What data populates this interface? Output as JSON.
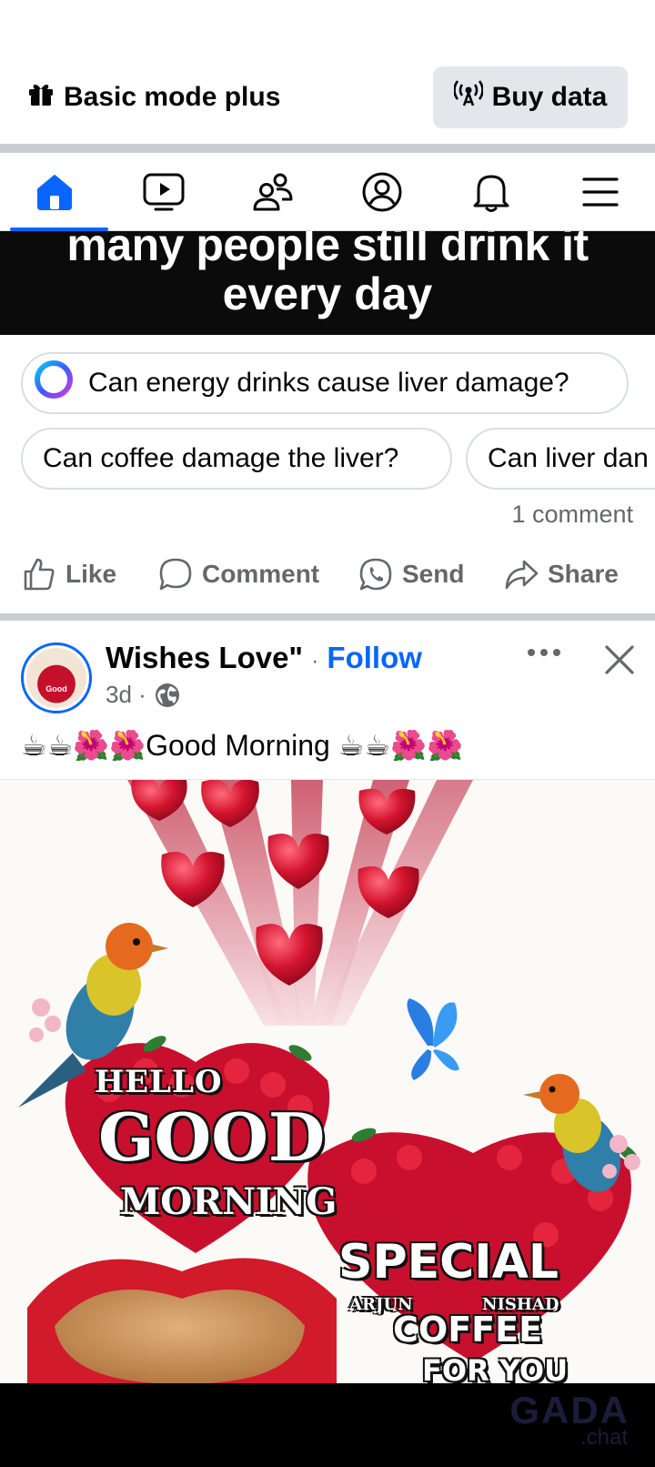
{
  "top_bar": {
    "basic_mode_label": "Basic mode plus",
    "buy_data_label": "Buy data"
  },
  "nav": {
    "items": [
      {
        "name": "home",
        "active": true
      },
      {
        "name": "video",
        "active": false
      },
      {
        "name": "friends",
        "active": false
      },
      {
        "name": "profile",
        "active": false
      },
      {
        "name": "notifications",
        "active": false
      },
      {
        "name": "menu",
        "active": false
      }
    ],
    "accent_color": "#0866ff"
  },
  "prev_post": {
    "image_headline_line1": "many people still drink it",
    "image_headline_line2": "every day",
    "ai_question": "Can energy drinks cause liver damage?",
    "related_questions": [
      "Can coffee damage the liver?",
      "Can liver dan"
    ],
    "comment_count": "1 comment",
    "actions": {
      "like": "Like",
      "comment": "Comment",
      "send": "Send",
      "share": "Share"
    }
  },
  "post": {
    "author": "Wishes Love\"",
    "separator": "·",
    "follow_label": "Follow",
    "time": "3d ·",
    "caption": "☕☕🌺🌺Good Morning ☕☕🌺🌺",
    "image_text": {
      "hello": "HELLO",
      "good": "GOOD",
      "morning": "MORNING",
      "special": "SPECIAL",
      "artist_left": "ARJUN",
      "artist_right": "NISHAD",
      "coffee": "COFFEE",
      "for_you": "FOR YOU"
    },
    "avatar_text": "Good"
  },
  "watermark": {
    "main": "GADA",
    "sub": ".chat"
  }
}
